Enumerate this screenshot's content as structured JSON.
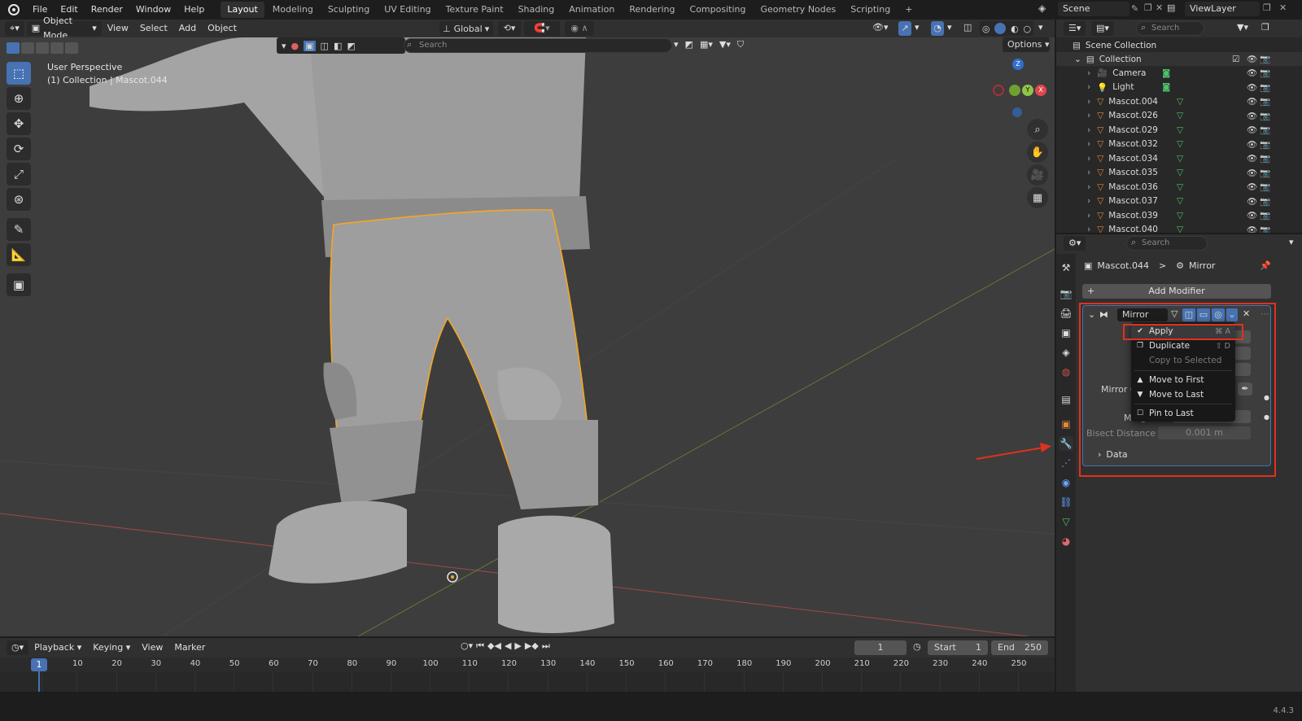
{
  "menu": {
    "items": [
      "File",
      "Edit",
      "Render",
      "Window",
      "Help"
    ]
  },
  "workspaces": [
    "Layout",
    "Modeling",
    "Sculpting",
    "UV Editing",
    "Texture Paint",
    "Shading",
    "Animation",
    "Rendering",
    "Compositing",
    "Geometry Nodes",
    "Scripting"
  ],
  "active_workspace": "Layout",
  "add_tab_label": "+",
  "scene": {
    "name": "Scene"
  },
  "view_layer": {
    "name": "ViewLayer"
  },
  "viewport_header": {
    "mode": "Object Mode",
    "menus": [
      "View",
      "Select",
      "Add",
      "Object"
    ],
    "orientation": "Global",
    "search_placeholder": "Search",
    "options_label": "Options"
  },
  "viewport": {
    "perspective_label": "User Perspective",
    "collection_label": "(1) Collection | Mascot.044",
    "gizmo_axes": {
      "z": "Z",
      "y": "Y",
      "x": "X"
    }
  },
  "timeline": {
    "menus": [
      "Playback",
      "Keying",
      "View",
      "Marker"
    ],
    "current_frame": "1",
    "start_label": "Start",
    "start_value": "1",
    "end_label": "End",
    "end_value": "250",
    "ticks": [
      "1",
      "10",
      "20",
      "30",
      "40",
      "50",
      "60",
      "70",
      "80",
      "90",
      "100",
      "110",
      "120",
      "130",
      "140",
      "150",
      "160",
      "170",
      "180",
      "190",
      "200",
      "210",
      "220",
      "230",
      "240",
      "250"
    ]
  },
  "status": {
    "version": "4.4.3"
  },
  "outliner": {
    "search_placeholder": "Search",
    "scene_collection": "Scene Collection",
    "collection": "Collection",
    "items": [
      "Camera",
      "Light",
      "Mascot.004",
      "Mascot.026",
      "Mascot.029",
      "Mascot.032",
      "Mascot.034",
      "Mascot.035",
      "Mascot.036",
      "Mascot.037",
      "Mascot.039",
      "Mascot.040"
    ]
  },
  "properties": {
    "search_placeholder": "Search",
    "object_name": "Mascot.044",
    "breadcrumb_sep": ">",
    "modifier_crumb": "Mirror",
    "add_modifier_label": "Add Modifier",
    "add_icon": "+",
    "modifier": {
      "name": "Mirror",
      "labels": {
        "mirror_object": "Mirror O",
        "merge": "Merge",
        "bisect_distance": "Bisect Distance",
        "data": "Data"
      },
      "bisect_value": "0.001 m"
    }
  },
  "context_menu": {
    "items": [
      {
        "label": "Apply",
        "shortcut": "⌘ A",
        "icon": "check-icon"
      },
      {
        "label": "Duplicate",
        "shortcut": "⇧ D",
        "icon": "duplicate-icon"
      },
      {
        "label": "Copy to Selected",
        "shortcut": "",
        "icon": "",
        "disabled": true
      },
      {
        "label": "Move to First",
        "shortcut": "",
        "icon": "triangle-up-icon"
      },
      {
        "label": "Move to Last",
        "shortcut": "",
        "icon": "triangle-down-icon"
      },
      {
        "label": "Pin to Last",
        "shortcut": "",
        "icon": "checkbox-icon"
      }
    ]
  },
  "colors": {
    "accent": "#4772b3",
    "selection_outline": "#f5a623",
    "highlight_red": "#e0321e"
  }
}
